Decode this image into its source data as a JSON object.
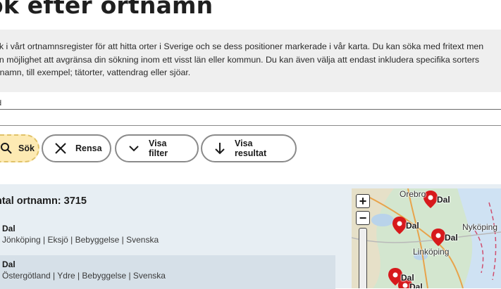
{
  "page": {
    "title": "ök efter ortnamn",
    "intro": [
      "ök i vårt ortnamnsregister för att hitta orter i Sverige och se dess positioner markerade i vår karta. Du kan söka med fritext men",
      "en möjlighet att avgränsa din sökning inom ett visst län eller kommun. Du kan även välja att endast inkludera specifika sorters",
      "rtnamn, till exempel; tätorter, vattendrag eller sjöar."
    ]
  },
  "search": {
    "value": "d"
  },
  "buttons": {
    "search": "Sök",
    "clear": "Rensa",
    "filter": "Visa filter",
    "results": "Visa resultat"
  },
  "results": {
    "count_label": "ntal ortnamn: 3715",
    "items": [
      {
        "name": "Dal",
        "meta": "Jönköping | Eksjö | Bebyggelse | Svenska"
      },
      {
        "name": "Dal",
        "meta": "Östergötland | Ydre | Bebyggelse | Svenska"
      }
    ]
  },
  "map": {
    "zoom_in": "+",
    "zoom_out": "−",
    "labels": [
      "Orebro",
      "Dal",
      "Nyköping",
      "Dal",
      "Dal",
      "Linköping",
      "Dal",
      "Dal"
    ],
    "marker_color": "#d7191c"
  }
}
